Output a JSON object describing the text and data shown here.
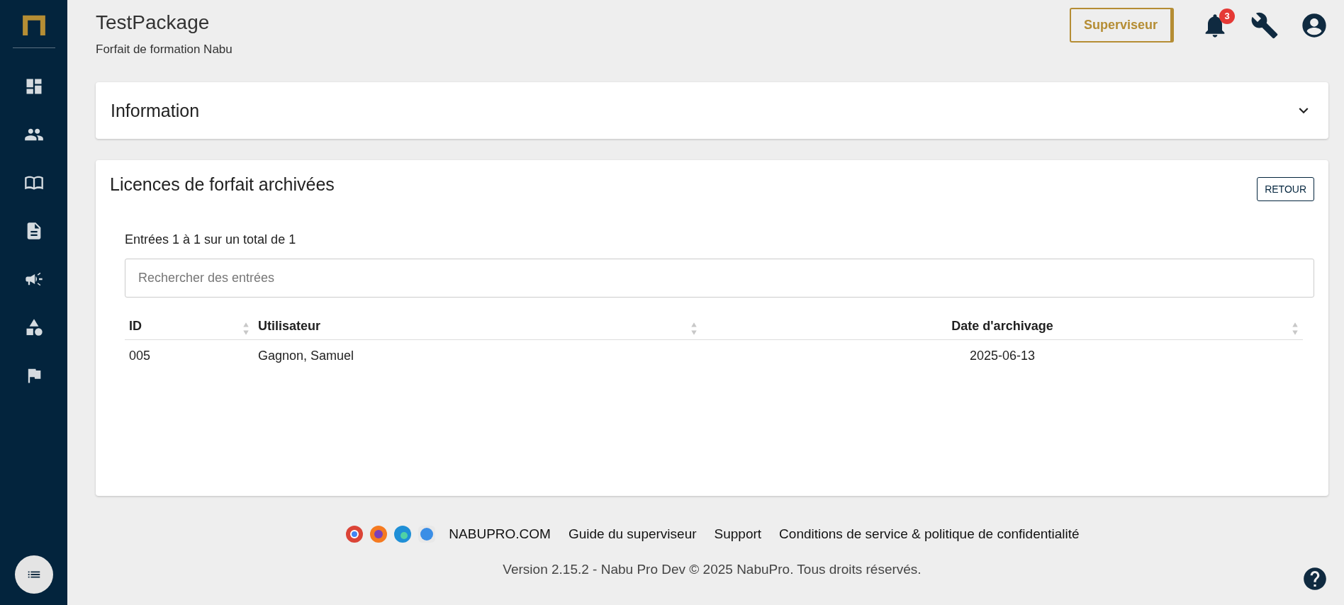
{
  "header": {
    "title": "TestPackage",
    "subtitle": "Forfait de formation Nabu"
  },
  "top_actions": {
    "role_button": "Superviseur",
    "notification_count": "3"
  },
  "information_panel": {
    "title": "Information",
    "expanded": false
  },
  "archived_panel": {
    "title": "Licences de forfait archivées",
    "back_button": "RETOUR",
    "entries_info": "Entrées 1 à 1 sur un total de 1",
    "search": {
      "placeholder": "Rechercher des entrées"
    },
    "table": {
      "columns": [
        "ID",
        "Utilisateur",
        "Date d'archivage"
      ],
      "rows": [
        [
          "005",
          "Gagnon, Samuel",
          "2025-06-13"
        ]
      ]
    }
  },
  "footer": {
    "links": [
      "NABUPRO.COM",
      "Guide du superviseur",
      "Support",
      "Conditions de service & politique de confidentialité"
    ],
    "copyright": "Version 2.15.2 - Nabu Pro Dev © 2025 NabuPro. Tous droits réservés."
  }
}
